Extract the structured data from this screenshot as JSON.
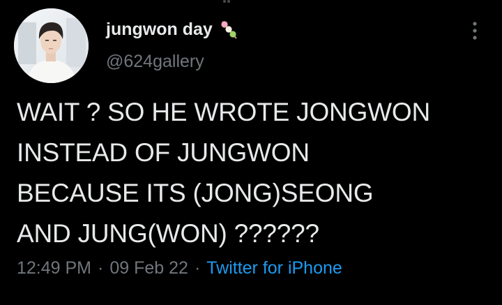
{
  "author": {
    "display_name": "jungwon day",
    "handle": "@624gallery",
    "name_emoji": "dango-icon"
  },
  "tweet": {
    "text": "WAIT ? SO HE WROTE JONGWON\nINSTEAD OF JUNGWON\nBECAUSE ITS (JONG)SEONG\nAND JUNG(WON) ??????"
  },
  "meta": {
    "time": "12:49 PM",
    "separator": "·",
    "date": "09 Feb 22",
    "source": "Twitter for iPhone"
  },
  "colors": {
    "background": "#000000",
    "primary_text": "#e7e9ea",
    "secondary_text": "#71767b",
    "link": "#1d9bf0"
  },
  "icons": {
    "more": "more-vertical-icon"
  }
}
